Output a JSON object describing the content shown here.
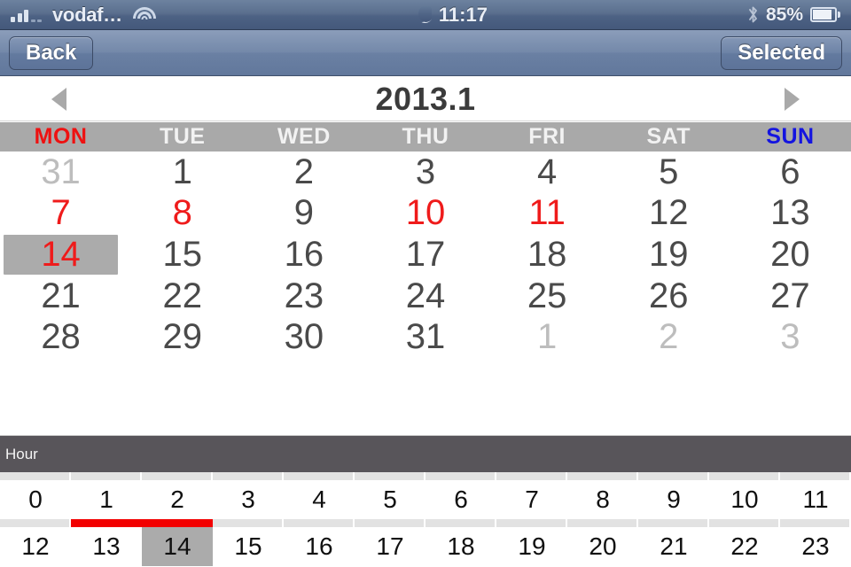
{
  "status_bar": {
    "carrier": "vodaf…",
    "signal_icon": "signal-bars-icon",
    "wifi_icon": "wifi-icon",
    "dnd_icon": "moon-do-not-disturb-icon",
    "time": "11:17",
    "bluetooth_icon": "bluetooth-icon",
    "battery_percent": "85%",
    "battery_icon": "battery-icon",
    "bg_color": "#4d6284",
    "text_color": "#e8edf5"
  },
  "nav_bar": {
    "back_label": "Back",
    "selected_label": "Selected",
    "bg_color": "#6a80a3"
  },
  "month_header": {
    "prev_icon": "chevron-left-icon",
    "next_icon": "chevron-right-icon",
    "title": "2013.1"
  },
  "weekday_header": {
    "bg_color": "#a9a9a9",
    "days": [
      {
        "label": "MON",
        "color": "#ee1111"
      },
      {
        "label": "TUE",
        "color": "#f2f2f2"
      },
      {
        "label": "WED",
        "color": "#f2f2f2"
      },
      {
        "label": "THU",
        "color": "#f2f2f2"
      },
      {
        "label": "FRI",
        "color": "#f2f2f2"
      },
      {
        "label": "SAT",
        "color": "#f2f2f2"
      },
      {
        "label": "SUN",
        "color": "#1414e0"
      }
    ]
  },
  "calendar": {
    "selected_day": "14",
    "selected_bg": "#ababab",
    "holiday_color": "#ef1b1b",
    "muted_color": "#bdbdbd",
    "normal_color": "#4a4a4a",
    "weeks": [
      [
        {
          "day": "31",
          "state": "muted"
        },
        {
          "day": "1",
          "state": "normal"
        },
        {
          "day": "2",
          "state": "normal"
        },
        {
          "day": "3",
          "state": "normal"
        },
        {
          "day": "4",
          "state": "normal"
        },
        {
          "day": "5",
          "state": "normal"
        },
        {
          "day": "6",
          "state": "normal"
        }
      ],
      [
        {
          "day": "7",
          "state": "holiday"
        },
        {
          "day": "8",
          "state": "holiday"
        },
        {
          "day": "9",
          "state": "normal"
        },
        {
          "day": "10",
          "state": "holiday"
        },
        {
          "day": "11",
          "state": "holiday"
        },
        {
          "day": "12",
          "state": "normal"
        },
        {
          "day": "13",
          "state": "normal"
        }
      ],
      [
        {
          "day": "14",
          "state": "holiday selected"
        },
        {
          "day": "15",
          "state": "normal"
        },
        {
          "day": "16",
          "state": "normal"
        },
        {
          "day": "17",
          "state": "normal"
        },
        {
          "day": "18",
          "state": "normal"
        },
        {
          "day": "19",
          "state": "normal"
        },
        {
          "day": "20",
          "state": "normal"
        }
      ],
      [
        {
          "day": "21",
          "state": "normal"
        },
        {
          "day": "22",
          "state": "normal"
        },
        {
          "day": "23",
          "state": "normal"
        },
        {
          "day": "24",
          "state": "normal"
        },
        {
          "day": "25",
          "state": "normal"
        },
        {
          "day": "26",
          "state": "normal"
        },
        {
          "day": "27",
          "state": "normal"
        }
      ],
      [
        {
          "day": "28",
          "state": "normal"
        },
        {
          "day": "29",
          "state": "normal"
        },
        {
          "day": "30",
          "state": "normal"
        },
        {
          "day": "31",
          "state": "normal"
        },
        {
          "day": "1",
          "state": "muted"
        },
        {
          "day": "2",
          "state": "muted"
        },
        {
          "day": "3",
          "state": "muted"
        }
      ]
    ]
  },
  "hour_section": {
    "label": "Hour",
    "label_bg": "#58555a",
    "marker_color": "#f20000",
    "selected_hour": "14",
    "selected_bg": "#ababab",
    "rows": [
      [
        {
          "hour": "0",
          "state": "normal"
        },
        {
          "hour": "1",
          "state": "marked"
        },
        {
          "hour": "2",
          "state": "marked"
        },
        {
          "hour": "3",
          "state": "normal"
        },
        {
          "hour": "4",
          "state": "normal"
        },
        {
          "hour": "5",
          "state": "normal"
        },
        {
          "hour": "6",
          "state": "normal"
        },
        {
          "hour": "7",
          "state": "normal"
        },
        {
          "hour": "8",
          "state": "normal"
        },
        {
          "hour": "9",
          "state": "normal"
        },
        {
          "hour": "10",
          "state": "normal"
        },
        {
          "hour": "11",
          "state": "normal"
        }
      ],
      [
        {
          "hour": "12",
          "state": "normal"
        },
        {
          "hour": "13",
          "state": "normal"
        },
        {
          "hour": "14",
          "state": "selected"
        },
        {
          "hour": "15",
          "state": "normal"
        },
        {
          "hour": "16",
          "state": "normal"
        },
        {
          "hour": "17",
          "state": "normal"
        },
        {
          "hour": "18",
          "state": "normal"
        },
        {
          "hour": "19",
          "state": "normal"
        },
        {
          "hour": "20",
          "state": "normal"
        },
        {
          "hour": "21",
          "state": "normal"
        },
        {
          "hour": "22",
          "state": "normal"
        },
        {
          "hour": "23",
          "state": "normal"
        }
      ]
    ]
  }
}
